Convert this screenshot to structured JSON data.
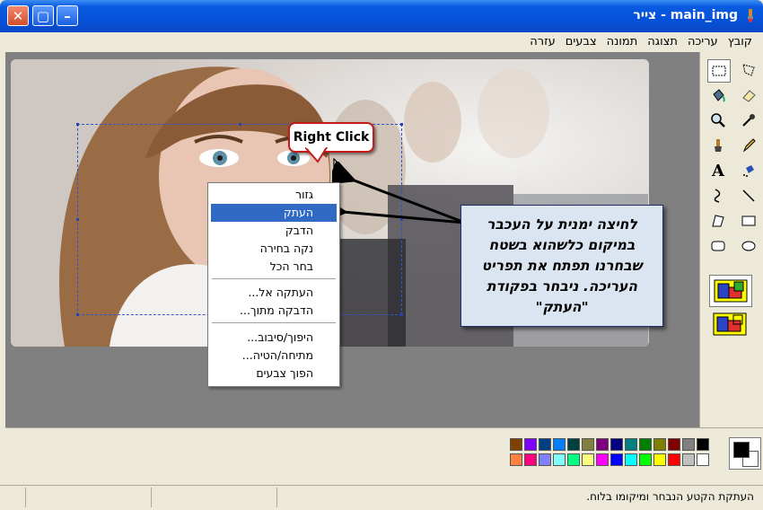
{
  "window": {
    "title": "main_img - צייר",
    "controls": {
      "close": "✕",
      "maximize": "▢",
      "minimize": "–"
    }
  },
  "menubar": {
    "items": [
      "קובץ",
      "עריכה",
      "תצוגה",
      "תמונה",
      "צבעים",
      "עזרה"
    ]
  },
  "context_menu": {
    "items": [
      {
        "label": "גזור",
        "selected": false
      },
      {
        "label": "העתק",
        "selected": true
      },
      {
        "label": "הדבק",
        "selected": false
      },
      {
        "label": "נקה בחירה",
        "selected": false
      },
      {
        "label": "בחר הכל",
        "selected": false
      },
      {
        "label": "העתקה אל...",
        "selected": false
      },
      {
        "label": "הדבקה מתוך...",
        "selected": false
      },
      {
        "label": "היפוך/סיבוב...",
        "selected": false
      },
      {
        "label": "מתיחה/הטיה...",
        "selected": false
      },
      {
        "label": "הפוך צבעים",
        "selected": false
      }
    ]
  },
  "annotation": {
    "bubble_label": "Right Click",
    "callout_lines": [
      "לחיצה ימנית על העכבר",
      "במיקום כלשהוא בשטח",
      "שבחרנו תפתח את תפריט",
      "העריכה. ניבחר בפקודת",
      "\"העתק\""
    ]
  },
  "toolbox": {
    "tools": [
      "free-select-icon",
      "rect-select-icon",
      "eraser-icon",
      "fill-icon",
      "color-picker-icon",
      "magnifier-icon",
      "pencil-icon",
      "brush-icon",
      "airbrush-icon",
      "text-icon",
      "line-icon",
      "curve-icon",
      "rectangle-icon",
      "polygon-icon",
      "ellipse-icon",
      "rounded-rect-icon"
    ]
  },
  "palette": {
    "primary": "#000000",
    "secondary": "#ffffff",
    "top_row": [
      "#000000",
      "#808080",
      "#800000",
      "#808000",
      "#008000",
      "#008080",
      "#000080",
      "#800080",
      "#808040",
      "#004040",
      "#0080ff",
      "#004080",
      "#8000ff",
      "#804000"
    ],
    "bottom_row": [
      "#ffffff",
      "#c0c0c0",
      "#ff0000",
      "#ffff00",
      "#00ff00",
      "#00ffff",
      "#0000ff",
      "#ff00ff",
      "#ffff80",
      "#00ff80",
      "#80ffff",
      "#8080ff",
      "#ff0080",
      "#ff8040"
    ]
  },
  "statusbar": {
    "text": "העתקת הקטע הנבחר ומיקומו בלוח."
  }
}
